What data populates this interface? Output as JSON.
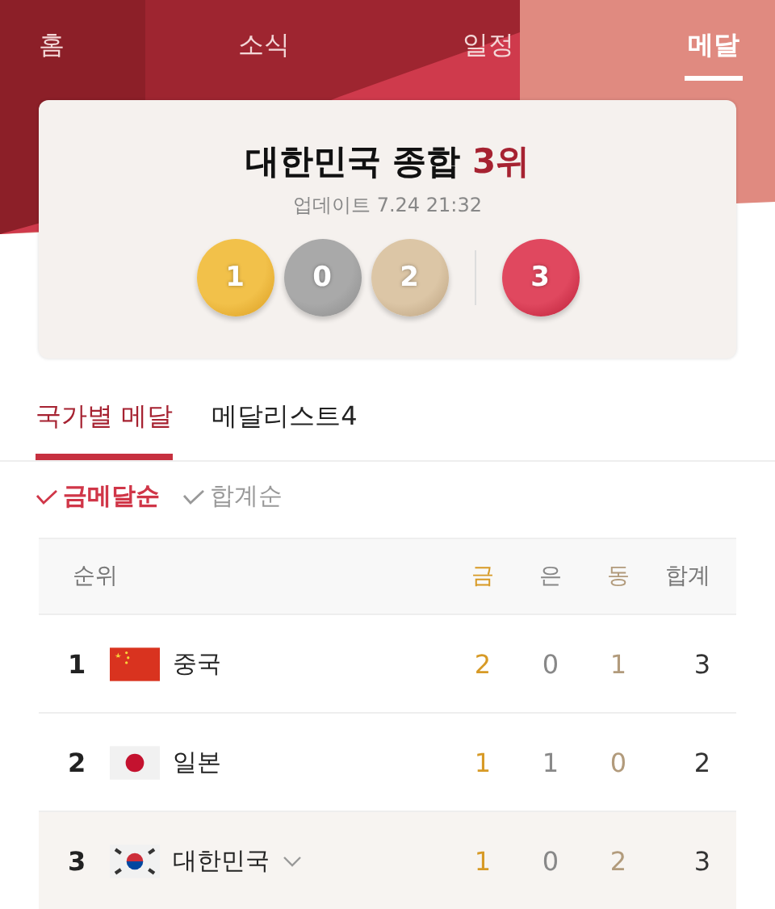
{
  "nav_tabs": [
    {
      "label": "홈",
      "selected": false
    },
    {
      "label": "소식",
      "selected": false
    },
    {
      "label": "일정",
      "selected": false
    },
    {
      "label": "메달",
      "selected": true
    }
  ],
  "summary": {
    "title": "대한민국 종합 **3위**",
    "updated": "업데이트 7.24 21:32",
    "medals": [
      {
        "kind": "gold",
        "count": "1"
      },
      {
        "kind": "silver",
        "count": "0"
      },
      {
        "kind": "bronze",
        "count": "2"
      },
      {
        "kind": "total",
        "count": "3"
      }
    ]
  },
  "sub_tabs": [
    {
      "label": "국가별 메달",
      "selected": true
    },
    {
      "label": "메달리스트",
      "count": "4",
      "selected": false
    }
  ],
  "sort_options": [
    {
      "label": "금메달순",
      "selected": true
    },
    {
      "label": "합계순",
      "selected": false
    }
  ],
  "table": {
    "columns": [
      {
        "label": "순위",
        "kind": "rank"
      },
      {
        "label": "금",
        "kind": "gold"
      },
      {
        "label": "은",
        "kind": "silver"
      },
      {
        "label": "동",
        "kind": "bronze"
      },
      {
        "label": "합계",
        "kind": "total"
      }
    ],
    "rows": [
      {
        "rank": "1",
        "kind": "china",
        "country": "중국",
        "gold": "2",
        "silver": "0",
        "bronze": "1",
        "total": "3",
        "highlighted": false,
        "expandable": false
      },
      {
        "rank": "2",
        "kind": "japan",
        "country": "일본",
        "gold": "1",
        "silver": "1",
        "bronze": "0",
        "total": "2",
        "highlighted": false,
        "expandable": false
      },
      {
        "rank": "3",
        "kind": "korea",
        "country": "대한민국",
        "gold": "1",
        "silver": "0",
        "bronze": "2",
        "total": "3",
        "highlighted": true,
        "expandable": true
      }
    ]
  }
}
